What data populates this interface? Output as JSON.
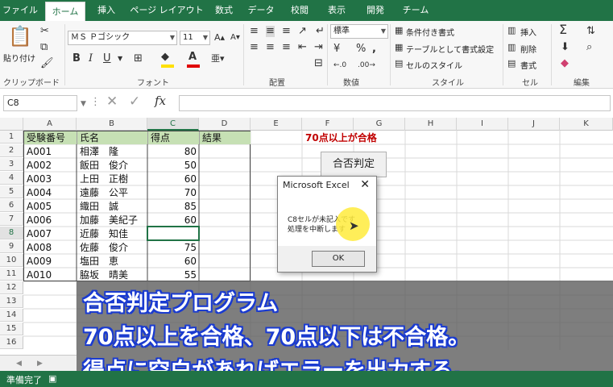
{
  "ribbon_tabs": [
    "ファイル",
    "ホーム",
    "挿入",
    "ページ レイアウト",
    "数式",
    "データ",
    "校閲",
    "表示",
    "開発",
    "チーム"
  ],
  "clipboard": {
    "paste": "貼り付け",
    "group": "クリップボード"
  },
  "font": {
    "name": "ＭＳ Ｐゴシック",
    "size": "11",
    "bold": "B",
    "italic": "I",
    "underline": "U",
    "group": "フォント",
    "font_color": "#e00000",
    "fill_color": "#ffe000"
  },
  "alignment": {
    "group": "配置"
  },
  "number": {
    "format": "標準",
    "percent": "%",
    "comma": ",",
    "group": "数値"
  },
  "styles": {
    "conditional": "条件付き書式",
    "table": "テーブルとして書式設定",
    "cell_styles": "セルのスタイル",
    "group": "スタイル"
  },
  "cells": {
    "insert": "挿入",
    "delete": "削除",
    "format": "書式",
    "group": "セル"
  },
  "editing": {
    "group": "編集"
  },
  "formula_bar": {
    "name_box": "C8",
    "fx": "fx",
    "value": ""
  },
  "columns": [
    "A",
    "B",
    "C",
    "D",
    "E",
    "F",
    "G",
    "H",
    "I",
    "J",
    "K"
  ],
  "rows": [
    "1",
    "2",
    "3",
    "4",
    "5",
    "6",
    "7",
    "8",
    "9",
    "10",
    "11",
    "12",
    "13",
    "14",
    "15",
    "16"
  ],
  "table": {
    "headers": [
      "受験番号",
      "氏名",
      "得点",
      "結果"
    ],
    "records": [
      [
        "A001",
        "相澤　隆",
        "80"
      ],
      [
        "A002",
        "飯田　俊介",
        "50"
      ],
      [
        "A003",
        "上田　正樹",
        "60"
      ],
      [
        "A004",
        "遠藤　公平",
        "70"
      ],
      [
        "A005",
        "織田　誠",
        "85"
      ],
      [
        "A006",
        "加藤　美紀子",
        "60"
      ],
      [
        "A007",
        "近藤　知佳",
        ""
      ],
      [
        "A008",
        "佐藤　俊介",
        "75"
      ],
      [
        "A009",
        "塩田　恵",
        "60"
      ],
      [
        "A010",
        "脇坂　晴美",
        "55"
      ]
    ]
  },
  "note": {
    "text": "70点以上が合格",
    "color": "#c00000"
  },
  "judge_button": "合否判定",
  "dialog": {
    "title": "Microsoft Excel",
    "line1": "C8セルが未記入です",
    "line2": "処理を中断します",
    "ok": "OK"
  },
  "banner": {
    "line1": "合否判定プログラム",
    "line2": "70点以上を合格、70点以下は不合格。",
    "line3": "得点に空白があればエラーを出力する。"
  },
  "status": {
    "ready": "準備完了"
  },
  "colors": {
    "accent": "#217346",
    "header_fill": "#c6e0b4"
  }
}
